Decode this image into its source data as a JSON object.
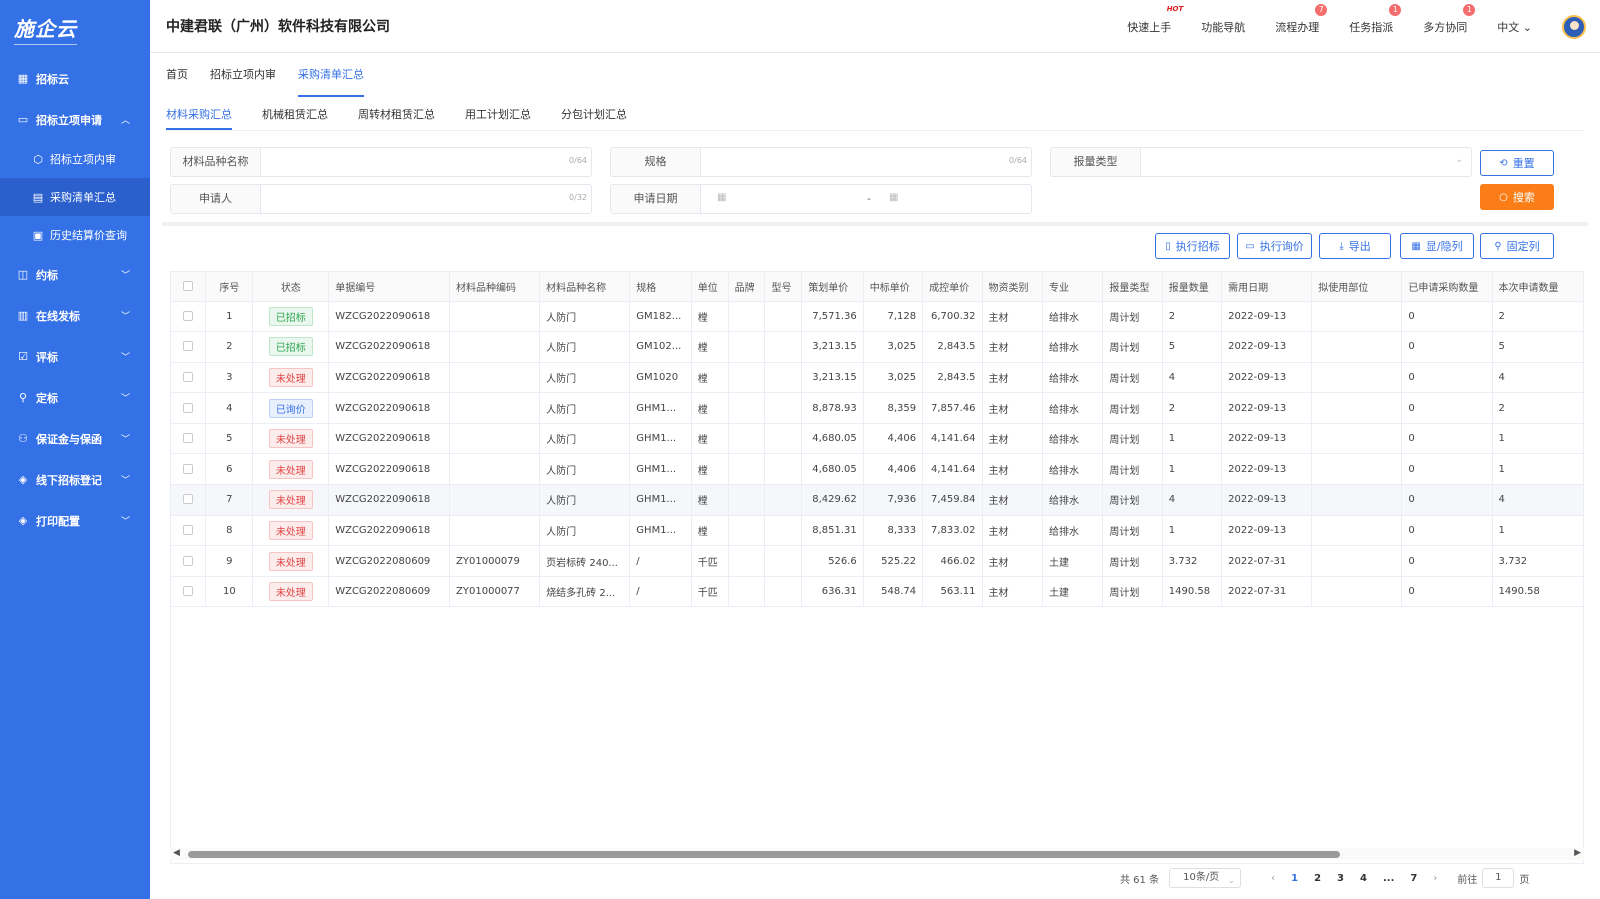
{
  "app": {
    "logo": "施企云",
    "company": "中建君联（广州）软件科技有限公司"
  },
  "header": {
    "nav": [
      {
        "label": "快速上手",
        "hot": "HOT"
      },
      {
        "label": "功能导航"
      },
      {
        "label": "流程办理",
        "badge": "7"
      },
      {
        "label": "任务指派",
        "badge": "1"
      },
      {
        "label": "多方协同",
        "badge": "1"
      }
    ],
    "lang": "中文"
  },
  "sidebar": {
    "items": [
      {
        "label": "招标云",
        "icon": "grid-icon"
      },
      {
        "label": "招标立项申请",
        "icon": "folder-icon",
        "expanded": true,
        "children": [
          {
            "label": "招标立项内审",
            "icon": "cube-icon"
          },
          {
            "label": "采购清单汇总",
            "icon": "table-icon",
            "active": true
          },
          {
            "label": "历史结算价查询",
            "icon": "document-icon"
          }
        ]
      },
      {
        "label": "约标",
        "icon": "wallet-icon"
      },
      {
        "label": "在线发标",
        "icon": "file-icon"
      },
      {
        "label": "评标",
        "icon": "check-square-icon"
      },
      {
        "label": "定标",
        "icon": "stamp-icon"
      },
      {
        "label": "保证金与保函",
        "icon": "people-icon"
      },
      {
        "label": "线下招标登记",
        "icon": "layers-icon"
      },
      {
        "label": "打印配置",
        "icon": "layers-icon"
      }
    ]
  },
  "breadcrumbs": [
    "首页",
    "招标立项内审",
    "采购清单汇总"
  ],
  "subtabs": [
    "材料采购汇总",
    "机械租赁汇总",
    "周转材租赁汇总",
    "用工计划汇总",
    "分包计划汇总"
  ],
  "filters": {
    "material_name": {
      "label": "材料品种名称",
      "count": "0/64"
    },
    "spec": {
      "label": "规格",
      "count": "0/64"
    },
    "report_type": {
      "label": "报量类型"
    },
    "applicant": {
      "label": "申请人",
      "count": "0/32"
    },
    "apply_date": {
      "label": "申请日期",
      "sep": "-"
    },
    "reset_label": "重置",
    "search_label": "搜索"
  },
  "toolbar": {
    "execute_bid": "执行招标",
    "execute_inquiry": "执行询价",
    "export": "导出",
    "show_hide": "显/隐列",
    "fix_col": "固定列"
  },
  "table": {
    "columns": [
      "序号",
      "状态",
      "单据编号",
      "材料品种编码",
      "材料品种名称",
      "规格",
      "单位",
      "品牌",
      "型号",
      "策划单价",
      "中标单价",
      "成控单价",
      "物资类别",
      "专业",
      "报量类型",
      "报量数量",
      "需用日期",
      "拟使用部位",
      "已申请采购数量",
      "本次申请数量"
    ],
    "rows": [
      {
        "no": "1",
        "status": "已招标",
        "status_color": "green",
        "doc": "WZCG2022090618",
        "code": "",
        "name": "人防门",
        "spec": "GM182...",
        "unit": "樘",
        "brand": "",
        "model": "",
        "plan": "7,571.36",
        "win": "7,128",
        "ctrl": "6,700.32",
        "cat": "主材",
        "major": "给排水",
        "rtype": "周计划",
        "qty": "2",
        "date": "2022-09-13",
        "part": "",
        "applied": "0",
        "cur": "2"
      },
      {
        "no": "2",
        "status": "已招标",
        "status_color": "green",
        "doc": "WZCG2022090618",
        "code": "",
        "name": "人防门",
        "spec": "GM102...",
        "unit": "樘",
        "brand": "",
        "model": "",
        "plan": "3,213.15",
        "win": "3,025",
        "ctrl": "2,843.5",
        "cat": "主材",
        "major": "给排水",
        "rtype": "周计划",
        "qty": "5",
        "date": "2022-09-13",
        "part": "",
        "applied": "0",
        "cur": "5"
      },
      {
        "no": "3",
        "status": "未处理",
        "status_color": "red",
        "doc": "WZCG2022090618",
        "code": "",
        "name": "人防门",
        "spec": "GM1020",
        "unit": "樘",
        "brand": "",
        "model": "",
        "plan": "3,213.15",
        "win": "3,025",
        "ctrl": "2,843.5",
        "cat": "主材",
        "major": "给排水",
        "rtype": "周计划",
        "qty": "4",
        "date": "2022-09-13",
        "part": "",
        "applied": "0",
        "cur": "4"
      },
      {
        "no": "4",
        "status": "已询价",
        "status_color": "blue",
        "doc": "WZCG2022090618",
        "code": "",
        "name": "人防门",
        "spec": "GHM1...",
        "unit": "樘",
        "brand": "",
        "model": "",
        "plan": "8,878.93",
        "win": "8,359",
        "ctrl": "7,857.46",
        "cat": "主材",
        "major": "给排水",
        "rtype": "周计划",
        "qty": "2",
        "date": "2022-09-13",
        "part": "",
        "applied": "0",
        "cur": "2"
      },
      {
        "no": "5",
        "status": "未处理",
        "status_color": "red",
        "doc": "WZCG2022090618",
        "code": "",
        "name": "人防门",
        "spec": "GHM1...",
        "unit": "樘",
        "brand": "",
        "model": "",
        "plan": "4,680.05",
        "win": "4,406",
        "ctrl": "4,141.64",
        "cat": "主材",
        "major": "给排水",
        "rtype": "周计划",
        "qty": "1",
        "date": "2022-09-13",
        "part": "",
        "applied": "0",
        "cur": "1"
      },
      {
        "no": "6",
        "status": "未处理",
        "status_color": "red",
        "doc": "WZCG2022090618",
        "code": "",
        "name": "人防门",
        "spec": "GHM1...",
        "unit": "樘",
        "brand": "",
        "model": "",
        "plan": "4,680.05",
        "win": "4,406",
        "ctrl": "4,141.64",
        "cat": "主材",
        "major": "给排水",
        "rtype": "周计划",
        "qty": "1",
        "date": "2022-09-13",
        "part": "",
        "applied": "0",
        "cur": "1"
      },
      {
        "no": "7",
        "status": "未处理",
        "status_color": "red",
        "doc": "WZCG2022090618",
        "code": "",
        "name": "人防门",
        "spec": "GHM1...",
        "unit": "樘",
        "brand": "",
        "model": "",
        "plan": "8,429.62",
        "win": "7,936",
        "ctrl": "7,459.84",
        "cat": "主材",
        "major": "给排水",
        "rtype": "周计划",
        "qty": "4",
        "date": "2022-09-13",
        "part": "",
        "applied": "0",
        "cur": "4",
        "highlight": true
      },
      {
        "no": "8",
        "status": "未处理",
        "status_color": "red",
        "doc": "WZCG2022090618",
        "code": "",
        "name": "人防门",
        "spec": "GHM1...",
        "unit": "樘",
        "brand": "",
        "model": "",
        "plan": "8,851.31",
        "win": "8,333",
        "ctrl": "7,833.02",
        "cat": "主材",
        "major": "给排水",
        "rtype": "周计划",
        "qty": "1",
        "date": "2022-09-13",
        "part": "",
        "applied": "0",
        "cur": "1"
      },
      {
        "no": "9",
        "status": "未处理",
        "status_color": "red",
        "doc": "WZCG2022080609",
        "code": "ZY01000079",
        "name": "页岩标砖 240...",
        "spec": "/",
        "unit": "千匹",
        "brand": "",
        "model": "",
        "plan": "526.6",
        "win": "525.22",
        "ctrl": "466.02",
        "cat": "主材",
        "major": "土建",
        "rtype": "周计划",
        "qty": "3.732",
        "date": "2022-07-31",
        "part": "",
        "applied": "0",
        "cur": "3.732"
      },
      {
        "no": "10",
        "status": "未处理",
        "status_color": "red",
        "doc": "WZCG2022080609",
        "code": "ZY01000077",
        "name": "烧结多孔砖 2...",
        "spec": "/",
        "unit": "千匹",
        "brand": "",
        "model": "",
        "plan": "636.31",
        "win": "548.74",
        "ctrl": "563.11",
        "cat": "主材",
        "major": "土建",
        "rtype": "周计划",
        "qty": "1490.58",
        "date": "2022-07-31",
        "part": "",
        "applied": "0",
        "cur": "1490.58"
      }
    ]
  },
  "pagination": {
    "total": "共 61 条",
    "page_size": "10条/页",
    "pages": [
      "1",
      "2",
      "3",
      "4",
      "...",
      "7"
    ],
    "current": "1",
    "goto_label": "前往",
    "goto_value": "1",
    "page_suffix": "页"
  }
}
